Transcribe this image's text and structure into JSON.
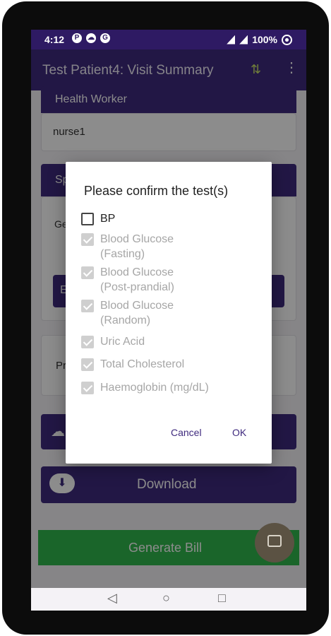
{
  "status_bar": {
    "time": "4:12",
    "notif_icons": [
      "P",
      "☁",
      "G"
    ],
    "battery": "100%"
  },
  "app_bar": {
    "title": "Test Patient4: Visit Summary",
    "sync_icon": "sync-icon",
    "menu_icon": "more-vert-icon"
  },
  "background": {
    "health_worker_header": "Health Worker",
    "health_worker_value": "nurse1",
    "specialty_header": "Sp",
    "specialty_row_text": "Ge",
    "upload_button_fragment": "E",
    "prescription_fragment": "Pr",
    "download_label": "Download",
    "generate_bill_label": "Generate Bill"
  },
  "dialog": {
    "title": "Please confirm the test(s)",
    "options": [
      {
        "label": "BP",
        "checked": false,
        "enabled": true
      },
      {
        "label": "Blood Glucose\n(Fasting)",
        "checked": true,
        "enabled": false
      },
      {
        "label": "Blood Glucose\n(Post-prandial)",
        "checked": true,
        "enabled": false
      },
      {
        "label": "Blood Glucose\n(Random)",
        "checked": true,
        "enabled": false
      },
      {
        "label": "Uric Acid",
        "checked": true,
        "enabled": false
      },
      {
        "label": "Total Cholesterol",
        "checked": true,
        "enabled": false
      },
      {
        "label": "Haemoglobin (mg/dL)",
        "checked": true,
        "enabled": false
      }
    ],
    "cancel_label": "Cancel",
    "ok_label": "OK"
  },
  "colors": {
    "primary": "#3f2a7e",
    "status_bar": "#2e1a63",
    "accent_green": "#31b94e"
  }
}
